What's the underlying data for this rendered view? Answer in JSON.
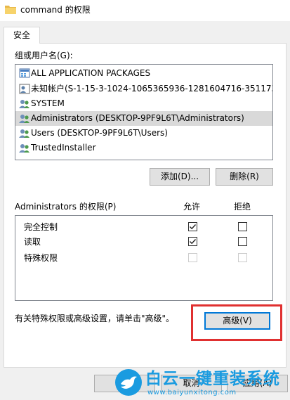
{
  "window": {
    "title": "command 的权限"
  },
  "tab": {
    "label": "安全"
  },
  "users_section": {
    "label": "组或用户名(G):",
    "items": [
      {
        "label": "ALL APPLICATION PACKAGES",
        "icon": "app-packages-icon"
      },
      {
        "label": "未知帐户(S-1-15-3-1024-1065365936-1281604716-351173...",
        "icon": "unknown-user-icon"
      },
      {
        "label": "SYSTEM",
        "icon": "group-icon"
      },
      {
        "label": "Administrators (DESKTOP-9PF9L6T\\Administrators)",
        "icon": "group-icon",
        "selected": true
      },
      {
        "label": "Users (DESKTOP-9PF9L6T\\Users)",
        "icon": "group-icon"
      },
      {
        "label": "TrustedInstaller",
        "icon": "group-icon"
      }
    ]
  },
  "buttons": {
    "add": "添加(D)...",
    "remove": "删除(R)",
    "advanced": "高级(V)",
    "cancel": "取消",
    "apply": "应用(A)"
  },
  "permissions": {
    "label": "Administrators 的权限(P)",
    "allow_header": "允许",
    "deny_header": "拒绝",
    "rows": [
      {
        "name": "完全控制",
        "allow": true,
        "deny": false,
        "disabled": false
      },
      {
        "name": "读取",
        "allow": true,
        "deny": false,
        "disabled": false
      },
      {
        "name": "特殊权限",
        "allow": false,
        "deny": false,
        "disabled": true
      }
    ]
  },
  "advanced_hint": "有关特殊权限或高级设置，请单击\"高级\"。",
  "watermark": {
    "brand": "白云一键重装系统",
    "url": "www.baiyunxitong.com"
  },
  "colors": {
    "highlight": "#e03030",
    "brand_blue": "#1a9be0",
    "selection": "#d9d9d9"
  }
}
